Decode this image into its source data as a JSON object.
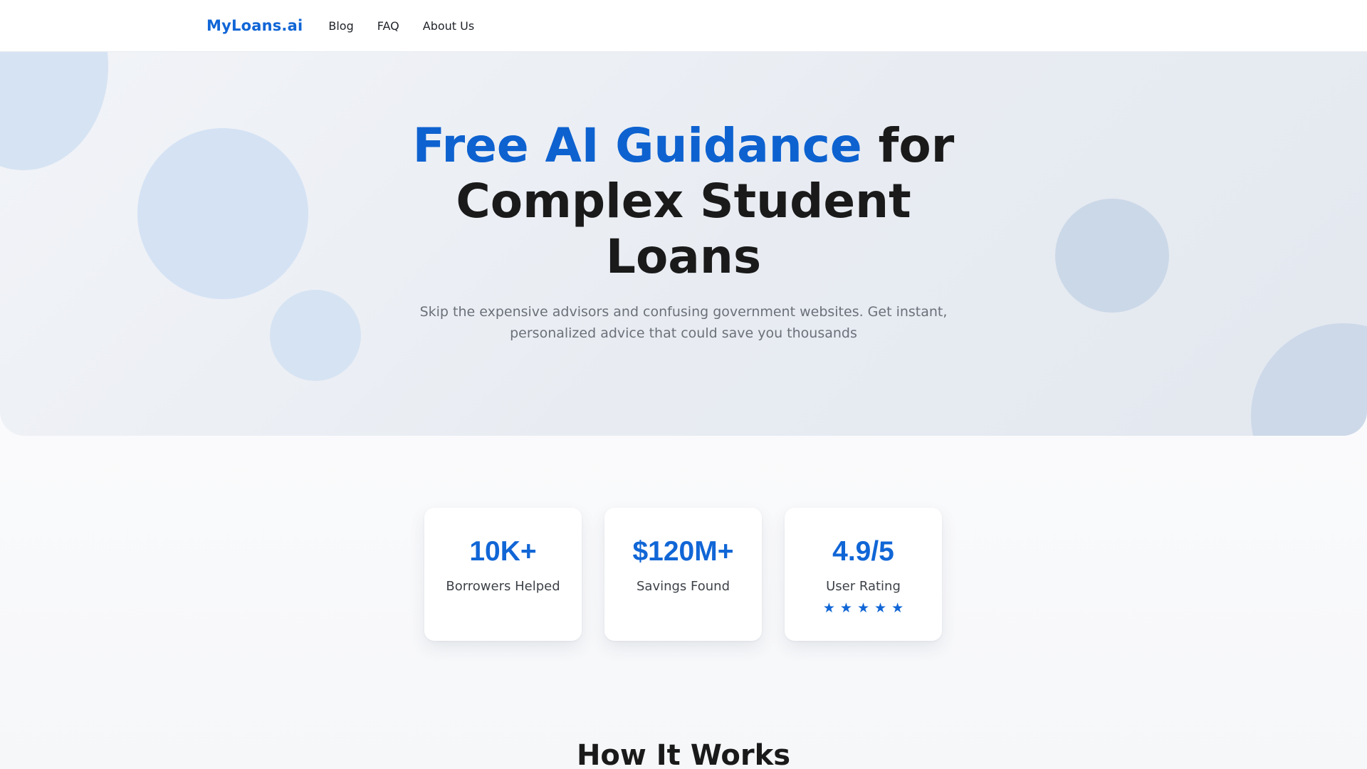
{
  "nav": {
    "logo": "MyLoans.ai",
    "links": [
      {
        "label": "Blog"
      },
      {
        "label": "FAQ"
      },
      {
        "label": "About Us"
      }
    ]
  },
  "hero": {
    "title_accent": "Free AI Guidance",
    "title_rest_line1": " for",
    "title_line2": "Complex Student",
    "title_line3": "Loans",
    "subtitle": "Skip the expensive advisors and confusing government websites. Get instant, personalized advice that could save you thousands"
  },
  "stats": [
    {
      "value": "10K+",
      "label": "Borrowers Helped"
    },
    {
      "value": "$120M+",
      "label": "Savings Found"
    },
    {
      "value": "4.9/5",
      "label": "User Rating",
      "rating": 5
    }
  ],
  "sections": {
    "how_it_works_title": "How It Works"
  },
  "colors": {
    "accent": "#1166d6",
    "text": "#1a1a1a",
    "muted": "#6b7079"
  },
  "icons": {
    "star": "star-icon"
  }
}
